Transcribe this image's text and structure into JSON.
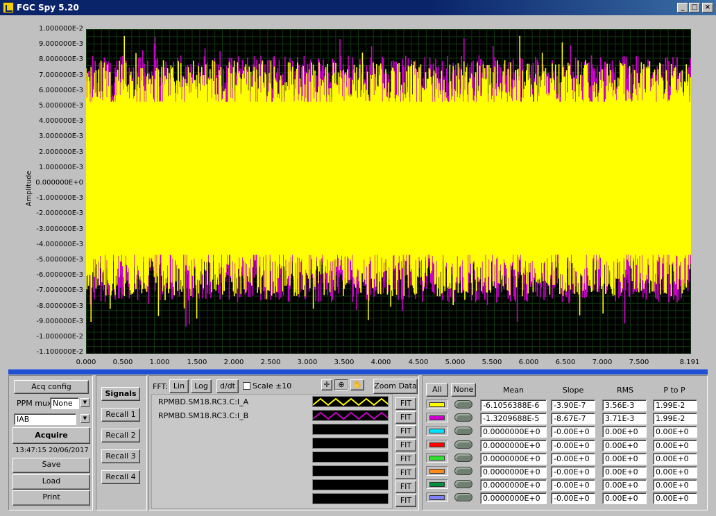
{
  "window": {
    "title": "FGC Spy 5.20"
  },
  "plot": {
    "ylabel": "Amplitude",
    "yticks": [
      "1.000000E-2",
      "9.000000E-3",
      "8.000000E-3",
      "7.000000E-3",
      "6.000000E-3",
      "5.000000E-3",
      "4.000000E-3",
      "3.000000E-3",
      "2.000000E-3",
      "1.000000E-3",
      "0.000000E+0",
      "-1.000000E-3",
      "-2.000000E-3",
      "-3.000000E-3",
      "-4.000000E-3",
      "-5.000000E-3",
      "-6.000000E-3",
      "-7.000000E-3",
      "-8.000000E-3",
      "-9.000000E-3",
      "-1.000000E-2",
      "-1.100000E-2"
    ],
    "xticks": [
      "0.000",
      "0.500",
      "1.000",
      "1.500",
      "2.000",
      "2.500",
      "3.000",
      "3.500",
      "4.000",
      "4.500",
      "5.000",
      "5.500",
      "6.000",
      "6.500",
      "7.000",
      "7.500",
      "8.191"
    ],
    "colors": {
      "background": "#000000",
      "grid": "#0f3a0f",
      "series_a": "#ffff00",
      "series_b": "#cc00cc"
    }
  },
  "chart_data": {
    "type": "line",
    "ylabel": "Amplitude",
    "xlim": [
      0.0,
      8.191
    ],
    "ylim": [
      -0.011,
      0.01
    ],
    "series": [
      {
        "name": "RPMBD.SM18.RC3.C:I_A",
        "color": "#ffff00",
        "rms": 0.00356,
        "peak_to_peak": 0.0199,
        "upper_envelope": 0.0065,
        "lower_envelope": -0.0058
      },
      {
        "name": "RPMBD.SM18.RC3.C:I_B",
        "color": "#cc00cc",
        "rms": 0.00371,
        "peak_to_peak": 0.0199,
        "upper_envelope": 0.0068,
        "lower_envelope": -0.0062
      }
    ]
  },
  "left": {
    "acq_config": "Acq config",
    "ppm_mux_label": "PPM mux",
    "ppm_mux_value": "None",
    "device_value": "IAB",
    "acquire": "Acquire",
    "timestamp": "13:47:15 20/06/2017",
    "save": "Save",
    "load": "Load",
    "print": "Print"
  },
  "recall": {
    "signals": "Signals",
    "items": [
      "Recall 1",
      "Recall 2",
      "Recall 3",
      "Recall 4"
    ]
  },
  "fft": {
    "label": "FFT:",
    "lin": "Lin",
    "log": "Log",
    "ddt": "d/dt",
    "scale": "Scale ±10",
    "zoom_data": "Zoom Data"
  },
  "signals": {
    "names": [
      "RPMBD.SM18.RC3.C:I_A",
      "RPMBD.SM18.RC3.C:I_B"
    ],
    "fit_label": "FIT"
  },
  "stats": {
    "all": "All",
    "none": "None",
    "headers": {
      "mean": "Mean",
      "slope": "Slope",
      "rms": "RMS",
      "ptop": "P to P"
    },
    "colors": [
      "#ffff00",
      "#cc00cc",
      "#00e0ff",
      "#ff0000",
      "#30e030",
      "#ff8c1a",
      "#009040",
      "#8080ff"
    ],
    "rows": [
      {
        "mean": "-6.1056388E-6",
        "slope": "-3.90E-7",
        "rms": "3.56E-3",
        "ptop": "1.99E-2"
      },
      {
        "mean": "-1.3209688E-5",
        "slope": "-8.67E-7",
        "rms": "3.71E-3",
        "ptop": "1.99E-2"
      },
      {
        "mean": "0.0000000E+0",
        "slope": "-0.00E+0",
        "rms": "0.00E+0",
        "ptop": "0.00E+0"
      },
      {
        "mean": "0.0000000E+0",
        "slope": "-0.00E+0",
        "rms": "0.00E+0",
        "ptop": "0.00E+0"
      },
      {
        "mean": "0.0000000E+0",
        "slope": "-0.00E+0",
        "rms": "0.00E+0",
        "ptop": "0.00E+0"
      },
      {
        "mean": "0.0000000E+0",
        "slope": "-0.00E+0",
        "rms": "0.00E+0",
        "ptop": "0.00E+0"
      },
      {
        "mean": "0.0000000E+0",
        "slope": "-0.00E+0",
        "rms": "0.00E+0",
        "ptop": "0.00E+0"
      },
      {
        "mean": "0.0000000E+0",
        "slope": "-0.00E+0",
        "rms": "0.00E+0",
        "ptop": "0.00E+0"
      }
    ]
  }
}
